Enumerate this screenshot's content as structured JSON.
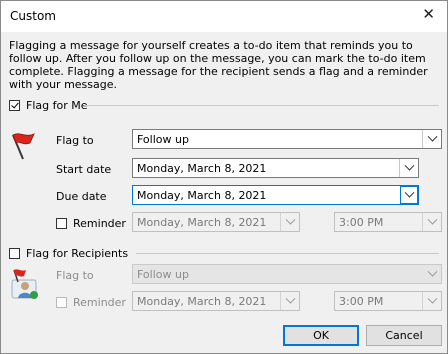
{
  "dialog": {
    "title": "Custom",
    "description": "Flagging a message for yourself creates a to-do item that reminds you to follow up. After you follow up on the message, you can mark the to-do item complete. Flagging a message for the recipient sends a flag and a reminder with your message."
  },
  "flag_for_me": {
    "checkbox_label": "Flag for Me",
    "checked": true,
    "icon": "red-flag-icon",
    "flag_to_label": "Flag to",
    "flag_to_value": "Follow up",
    "start_date_label": "Start date",
    "start_date_value": "Monday, March 8, 2021",
    "due_date_label": "Due date",
    "due_date_value": "Monday, March 8, 2021",
    "reminder_label": "Reminder",
    "reminder_checked": false,
    "reminder_date": "Monday, March 8, 2021",
    "reminder_time": "3:00 PM"
  },
  "flag_for_recipients": {
    "checkbox_label": "Flag for Recipients",
    "checked": false,
    "icon": "recipient-flag-icon",
    "flag_to_label": "Flag to",
    "flag_to_value": "Follow up",
    "reminder_label": "Reminder",
    "reminder_checked": false,
    "reminder_date": "Monday, March 8, 2021",
    "reminder_time": "3:00 PM"
  },
  "buttons": {
    "ok": "OK",
    "cancel": "Cancel"
  },
  "colors": {
    "accent": "#0078d7",
    "flag_red": "#d9261c"
  }
}
